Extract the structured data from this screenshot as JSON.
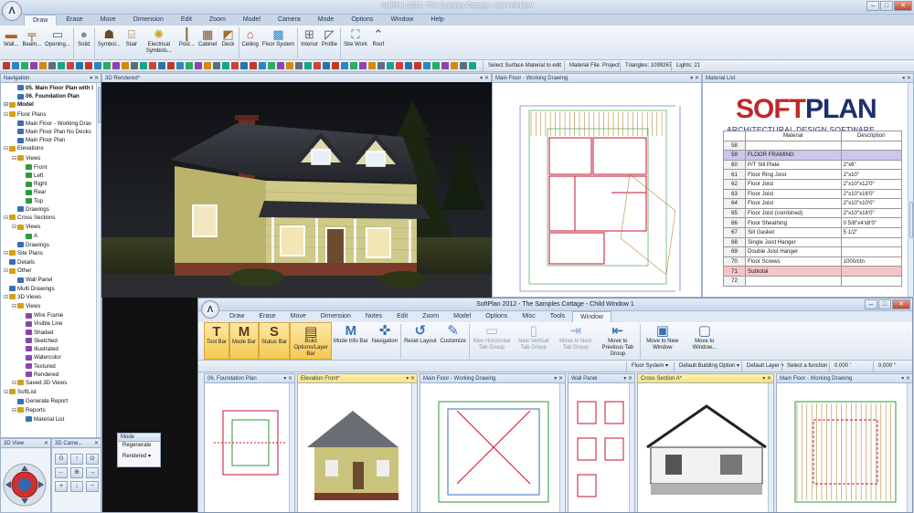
{
  "app": {
    "title": "SoftPlan 2012 - The Samples Cottage - Main Window",
    "logo_glyph": "Λ"
  },
  "menu": [
    "Draw",
    "Erase",
    "Move",
    "Dimension",
    "Edit",
    "Zoom",
    "Model",
    "Camera",
    "Mode",
    "Options",
    "Window",
    "Help"
  ],
  "ribbon": [
    {
      "label": "Wall...",
      "icon": "wall-icon",
      "glyph": "▬",
      "color": "#b5651d"
    },
    {
      "label": "Beam...",
      "icon": "beam-icon",
      "glyph": "╤",
      "color": "#8a5a2b"
    },
    {
      "label": "Opening...",
      "icon": "opening-icon",
      "glyph": "▭",
      "color": "#3b6fb6"
    },
    {
      "label": "Solid",
      "icon": "solid-icon",
      "glyph": "●",
      "color": "#7d8a99"
    },
    {
      "label": "Symbol...",
      "icon": "symbol-icon",
      "glyph": "☗",
      "color": "#6a4a2a"
    },
    {
      "label": "Stair",
      "icon": "stair-icon",
      "glyph": "⌸",
      "color": "#9a6a3a"
    },
    {
      "label": "Electrical Symbols...",
      "icon": "lightbulb-icon",
      "glyph": "✺",
      "color": "#c9a227"
    },
    {
      "label": "Post...",
      "icon": "post-icon",
      "glyph": "┃",
      "color": "#8a6a3a"
    },
    {
      "label": "Cabinet",
      "icon": "cabinet-icon",
      "glyph": "▦",
      "color": "#7a5230"
    },
    {
      "label": "Deck",
      "icon": "deck-icon",
      "glyph": "◩",
      "color": "#a06c35"
    },
    {
      "label": "Ceiling",
      "icon": "ceiling-icon",
      "glyph": "⌂",
      "color": "#c0392b"
    },
    {
      "label": "Floor System",
      "icon": "floor-system-icon",
      "glyph": "▩",
      "color": "#2e86c1"
    },
    {
      "label": "Interior",
      "icon": "interior-icon",
      "glyph": "⊞",
      "color": "#5d6d7e"
    },
    {
      "label": "Profile",
      "icon": "profile-icon",
      "glyph": "◸",
      "color": "#2e4053"
    },
    {
      "label": "Site Work",
      "icon": "site-work-icon",
      "glyph": "⛶",
      "color": "#1e8449"
    },
    {
      "label": "Roof",
      "icon": "roof-icon",
      "glyph": "⌃",
      "color": "#34495e"
    }
  ],
  "status": {
    "hint": "Select Surface Material to edit",
    "material_file": "Material File: Project",
    "triangles": "Triangles: 1099267",
    "lights": "Lights: 21"
  },
  "navigation": {
    "title": "Navigation",
    "tree": [
      {
        "label": "05. Main Floor Plan with I",
        "level": 1,
        "bold": true,
        "type": "file"
      },
      {
        "label": "06. Foundation Plan",
        "level": 1,
        "bold": true,
        "type": "file"
      },
      {
        "label": "Model",
        "level": 0,
        "bold": true,
        "type": "folder"
      },
      {
        "label": "Floor Plans",
        "level": 0,
        "type": "folder"
      },
      {
        "label": "Main Floor - Working Drav",
        "level": 1,
        "type": "file"
      },
      {
        "label": "Main Floor Plan No Decks",
        "level": 1,
        "type": "file"
      },
      {
        "label": "Main Floor Plan",
        "level": 1,
        "type": "file"
      },
      {
        "label": "Elevations",
        "level": 0,
        "type": "folder"
      },
      {
        "label": "Views",
        "level": 1,
        "type": "folder"
      },
      {
        "label": "Front",
        "level": 2,
        "type": "arrow"
      },
      {
        "label": "Left",
        "level": 2,
        "type": "arrow"
      },
      {
        "label": "Right",
        "level": 2,
        "type": "arrow"
      },
      {
        "label": "Rear",
        "level": 2,
        "type": "arrow"
      },
      {
        "label": "Top",
        "level": 2,
        "type": "arrow"
      },
      {
        "label": "Drawings",
        "level": 1,
        "type": "file"
      },
      {
        "label": "Cross Sections",
        "level": 0,
        "type": "folder"
      },
      {
        "label": "Views",
        "level": 1,
        "type": "folder"
      },
      {
        "label": "A",
        "level": 2,
        "type": "arrow"
      },
      {
        "label": "Drawings",
        "level": 1,
        "type": "file"
      },
      {
        "label": "Site Plans",
        "level": 0,
        "type": "folder"
      },
      {
        "label": "Details",
        "level": 0,
        "type": "file"
      },
      {
        "label": "Other",
        "level": 0,
        "type": "folder"
      },
      {
        "label": "Wall Panel",
        "level": 1,
        "type": "file"
      },
      {
        "label": "Multi Drawings",
        "level": 0,
        "type": "file"
      },
      {
        "label": "3D Views",
        "level": 0,
        "type": "folder"
      },
      {
        "label": "Views",
        "level": 1,
        "type": "folder"
      },
      {
        "label": "Wire Frame",
        "level": 2,
        "type": "view"
      },
      {
        "label": "Visible Line",
        "level": 2,
        "type": "view"
      },
      {
        "label": "Shaded",
        "level": 2,
        "type": "view"
      },
      {
        "label": "Sketched",
        "level": 2,
        "type": "view"
      },
      {
        "label": "Illustrated",
        "level": 2,
        "type": "view"
      },
      {
        "label": "Watercolor",
        "level": 2,
        "type": "view"
      },
      {
        "label": "Textured",
        "level": 2,
        "type": "view"
      },
      {
        "label": "Rendered",
        "level": 2,
        "type": "view"
      },
      {
        "label": "Saved 3D Views",
        "level": 1,
        "type": "folder"
      },
      {
        "label": "SoftList",
        "level": 0,
        "type": "folder"
      },
      {
        "label": "Generate Report",
        "level": 1,
        "type": "file"
      },
      {
        "label": "Reports",
        "level": 1,
        "type": "folder"
      },
      {
        "label": "Material List",
        "level": 2,
        "type": "file"
      }
    ]
  },
  "panes": {
    "rendered": "3D Rendered*",
    "working": "Main Floor - Working Drawing",
    "material": "Material List",
    "view3d": "3D View",
    "camera": "3D Came..."
  },
  "mode_box": {
    "title": "Mode",
    "regenerate": "Regenerate",
    "rendered": "Rendered"
  },
  "material_list": {
    "brand_a": "SOFT",
    "brand_b": "PLAN",
    "tagline": "ARCHITECTURAL DESIGN SOFTWARE",
    "col_material": "Material",
    "col_description": "Description",
    "rows": [
      {
        "n": "58",
        "m": "",
        "d": "",
        "kind": "plain"
      },
      {
        "n": "59",
        "m": "FLOOR FRAMING",
        "d": "",
        "kind": "section"
      },
      {
        "n": "60",
        "m": "P/T Sill Plate",
        "d": "2\"x6\"",
        "kind": "plain"
      },
      {
        "n": "61",
        "m": "Floor Ring Joist",
        "d": "2\"x10\"",
        "kind": "plain"
      },
      {
        "n": "62",
        "m": "Floor Joist",
        "d": "2\"x10\"x12'0\"",
        "kind": "plain"
      },
      {
        "n": "63",
        "m": "Floor Joist",
        "d": "2\"x10\"x16'0\"",
        "kind": "plain"
      },
      {
        "n": "64",
        "m": "Floor Joist",
        "d": "2\"x10\"x10'0\"",
        "kind": "plain"
      },
      {
        "n": "65",
        "m": "Floor Joist (combined)",
        "d": "2\"x10\"x16'0\"",
        "kind": "plain"
      },
      {
        "n": "66",
        "m": "Floor Sheathing",
        "d": "0 5/8\"x4'x8'0\"",
        "kind": "plain"
      },
      {
        "n": "67",
        "m": "Sill Gasket",
        "d": "5 1/2\"",
        "kind": "plain"
      },
      {
        "n": "68",
        "m": "Single Joist Hanger",
        "d": "",
        "kind": "plain"
      },
      {
        "n": "69",
        "m": "Double Joist Hanger",
        "d": "",
        "kind": "plain"
      },
      {
        "n": "70",
        "m": "Floor Screws",
        "d": "1000/ctn",
        "kind": "plain"
      },
      {
        "n": "71",
        "m": "Subtotal",
        "d": "",
        "kind": "subtotal"
      },
      {
        "n": "72",
        "m": "",
        "d": "",
        "kind": "plain"
      }
    ]
  },
  "child": {
    "title": "SoftPlan 2012 - The Samples Cottage - Child Window 1",
    "menu": [
      "Draw",
      "Erase",
      "Move",
      "Dimension",
      "Notes",
      "Edit",
      "Zoom",
      "Model",
      "Options",
      "Misc",
      "Tools",
      "Window"
    ],
    "ribbon": [
      {
        "label": "Tool Bar",
        "glyph": "T",
        "active": true
      },
      {
        "label": "Mode Bar",
        "glyph": "M",
        "active": true
      },
      {
        "label": "Status Bar",
        "glyph": "S",
        "active": true
      },
      {
        "label": "Build Options/Layer Bar",
        "glyph": "▤",
        "active": true
      },
      {
        "label": "Mode Info Bar",
        "glyph": "M",
        "active": false
      },
      {
        "label": "Navigation",
        "glyph": "✜",
        "active": false
      },
      {
        "label": "Reset Layout",
        "glyph": "↺",
        "active": false
      },
      {
        "label": "Customize",
        "glyph": "✎",
        "active": false
      },
      {
        "label": "New Horizontal Tab Group",
        "glyph": "▭",
        "active": false,
        "disabled": true
      },
      {
        "label": "New Vertical Tab Group",
        "glyph": "▯",
        "active": false,
        "disabled": true
      },
      {
        "label": "Move to Next Tab Group",
        "glyph": "⇥",
        "active": false,
        "disabled": true
      },
      {
        "label": "Move to Previous Tab Group",
        "glyph": "⇤",
        "active": false
      },
      {
        "label": "Move to New Window",
        "glyph": "▣",
        "active": false
      },
      {
        "label": "Move to Window...",
        "glyph": "▢",
        "active": false
      }
    ],
    "toolbar": {
      "floor_system": "Floor System",
      "build_option": "Default Building Option",
      "layer": "Default Layer",
      "hint": "Select a function",
      "val1": "0.000 '",
      "val2": "0.000 °"
    },
    "tabs": [
      {
        "label": "06. Foundation Plan",
        "highlight": false
      },
      {
        "label": "Elevation Front*",
        "highlight": true
      },
      {
        "label": "Main Floor - Working Drawing",
        "highlight": false
      },
      {
        "label": "Wall Panel",
        "highlight": false
      },
      {
        "label": "Cross Section A*",
        "highlight": true
      },
      {
        "label": "Main Floor - Working Drawing",
        "highlight": false
      }
    ]
  },
  "colors": {
    "brand_red": "#c0272d",
    "brand_navy": "#1d2f6f",
    "section_purple": "#cdc7ea",
    "subtotal_pink": "#f5c3c8",
    "house_siding": "#c9c37c",
    "tab_highlight": "#f6e27a"
  }
}
